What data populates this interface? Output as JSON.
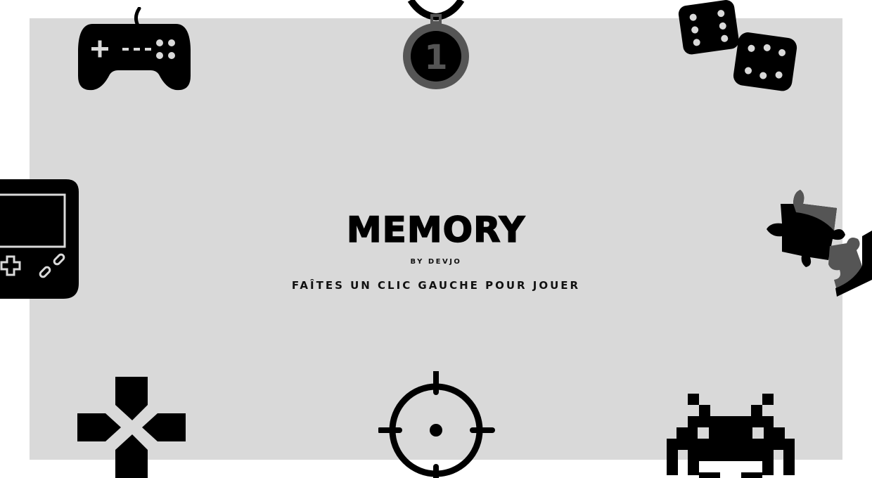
{
  "screen": {
    "title": "MEMORY",
    "byline": "BY DEVJO",
    "instruction": "FAÎTES UN CLIC GAUCHE POUR JOUER",
    "medal_number": "1"
  },
  "colors": {
    "panel": "#d9d9d9",
    "background": "#ffffff",
    "icon": "#000000",
    "accent_gray": "#555555"
  },
  "icons": [
    "gamepad-icon",
    "medal-icon",
    "dice-icon",
    "handheld-console-icon",
    "puzzle-icon",
    "dpad-icon",
    "crosshair-icon",
    "space-invader-icon"
  ]
}
